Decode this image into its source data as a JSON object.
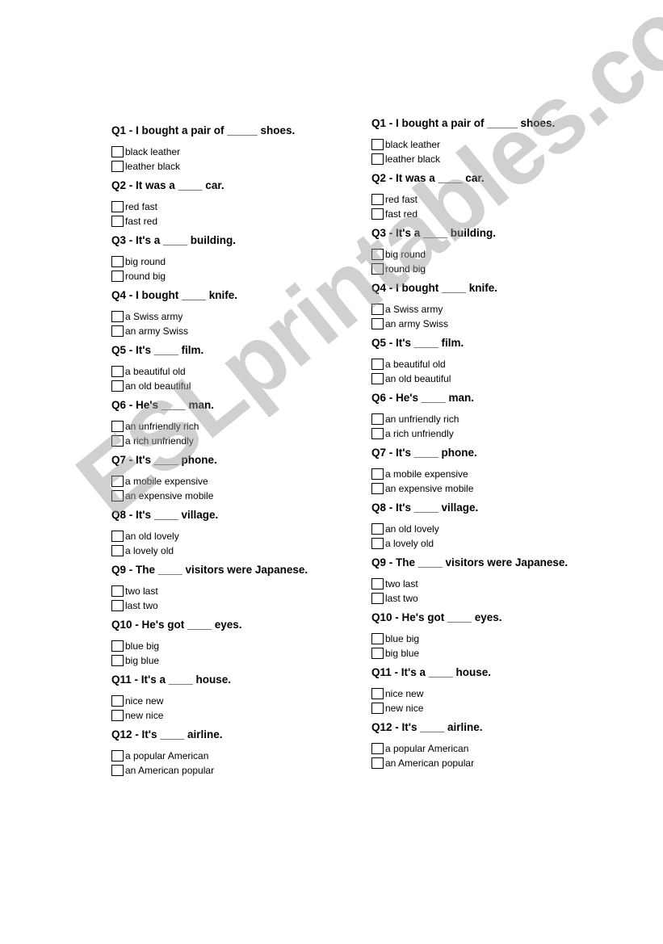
{
  "watermark": "ESLprintables.com",
  "columns": [
    {
      "questions": [
        {
          "title": "Q1 - I bought a pair of _____ shoes.",
          "options": [
            "black leather",
            "leather black"
          ]
        },
        {
          "title": "Q2 - It was a ____ car.",
          "options": [
            "red fast",
            "fast red"
          ]
        },
        {
          "title": "Q3 - It's a ____ building.",
          "options": [
            "big round",
            "round big"
          ]
        },
        {
          "title": "Q4 - I bought ____ knife.",
          "options": [
            "a Swiss army",
            "an army Swiss"
          ]
        },
        {
          "title": "Q5 - It's ____ film.",
          "options": [
            "a beautiful old",
            "an old beautiful"
          ]
        },
        {
          "title": "Q6 - He's ____ man.",
          "options": [
            "an unfriendly rich",
            "a rich unfriendly"
          ]
        },
        {
          "title": "Q7 - It's ____ phone.",
          "options": [
            "a mobile expensive",
            "an expensive mobile"
          ]
        },
        {
          "title": "Q8 - It's ____ village.",
          "options": [
            "an old lovely",
            "a lovely old"
          ]
        },
        {
          "title": "Q9 - The ____ visitors were Japanese.",
          "options": [
            "two last",
            "last two"
          ]
        },
        {
          "title": "Q10 - He's got ____ eyes.",
          "options": [
            "blue big",
            "big blue"
          ]
        },
        {
          "title": "Q11 - It's a ____ house.",
          "options": [
            "nice new",
            "new nice"
          ]
        },
        {
          "title": "Q12 - It's ____ airline.",
          "options": [
            "a popular American",
            "an American popular"
          ]
        }
      ]
    },
    {
      "questions": [
        {
          "title": "Q1 - I bought a pair of _____ shoes.",
          "options": [
            "black leather",
            "leather black"
          ]
        },
        {
          "title": "Q2 - It was a ____ car.",
          "options": [
            "red fast",
            "fast red"
          ]
        },
        {
          "title": "Q3 - It's a ____ building.",
          "options": [
            "big round",
            "round big"
          ]
        },
        {
          "title": "Q4 - I bought ____ knife.",
          "options": [
            "a Swiss army",
            "an army Swiss"
          ]
        },
        {
          "title": "Q5 - It's ____ film.",
          "options": [
            "a beautiful old",
            "an old beautiful"
          ]
        },
        {
          "title": "Q6 - He's ____ man.",
          "options": [
            "an unfriendly rich",
            "a rich unfriendly"
          ]
        },
        {
          "title": "Q7 - It's ____ phone.",
          "options": [
            "a mobile expensive",
            "an expensive mobile"
          ]
        },
        {
          "title": "Q8 - It's ____ village.",
          "options": [
            "an old lovely",
            "a lovely old"
          ]
        },
        {
          "title": "Q9 - The ____ visitors were Japanese.",
          "options": [
            "two last",
            "last two"
          ]
        },
        {
          "title": "Q10 - He's got ____ eyes.",
          "options": [
            "blue big",
            "big blue"
          ]
        },
        {
          "title": "Q11 - It's a ____ house.",
          "options": [
            "nice new",
            "new nice"
          ]
        },
        {
          "title": "Q12 - It's ____ airline.",
          "options": [
            "a popular American",
            "an American popular"
          ]
        }
      ]
    }
  ]
}
